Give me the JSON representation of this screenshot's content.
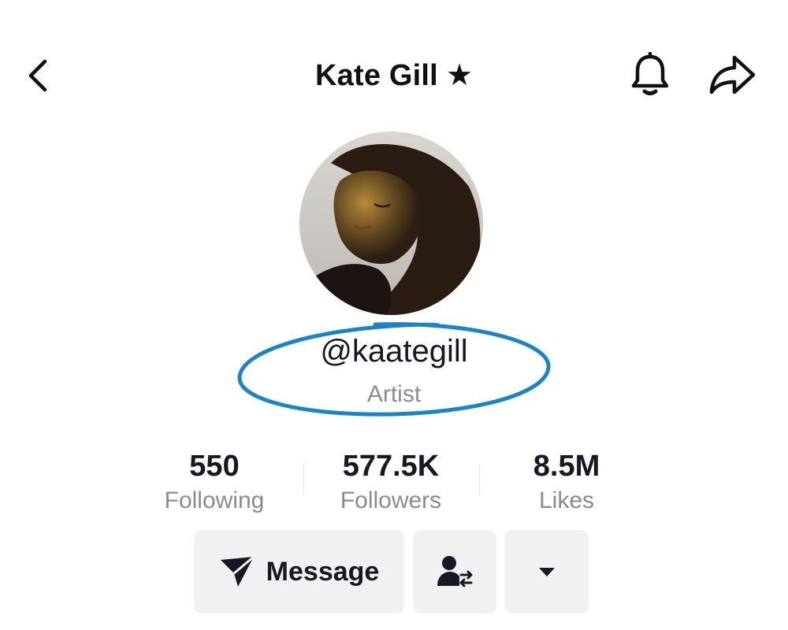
{
  "header": {
    "title": "Kate Gill",
    "star": "★",
    "back_icon": "chevron-left-icon",
    "bell_icon": "bell-icon",
    "share_icon": "share-arrow-icon"
  },
  "profile": {
    "handle": "@kaategill",
    "bio": "Artist",
    "annotation_color": "#1c84c6"
  },
  "stats": [
    {
      "value": "550",
      "label": "Following"
    },
    {
      "value": "577.5K",
      "label": "Followers"
    },
    {
      "value": "8.5M",
      "label": "Likes"
    }
  ],
  "actions": {
    "message_label": "Message",
    "message_icon": "send-icon",
    "friends_icon": "person-swap-icon",
    "more_icon": "caret-down-icon"
  }
}
